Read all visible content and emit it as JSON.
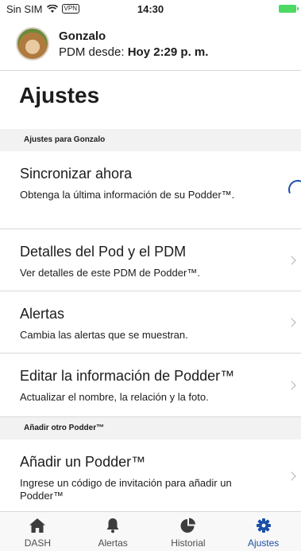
{
  "status": {
    "carrier": "Sin SIM",
    "vpn": "VPN",
    "time": "14:30"
  },
  "user": {
    "name": "Gonzalo",
    "pdm_prefix": "PDM desde:",
    "pdm_time": "Hoy 2:29 p. m."
  },
  "page_title": "Ajustes",
  "section_user": "Ajustes para Gonzalo",
  "rows": [
    {
      "title": "Sincronizar ahora",
      "description": "Obtenga la última información de su Podder™."
    },
    {
      "title": "Detalles del Pod y el PDM",
      "description": "Ver detalles de este PDM de Podder™."
    },
    {
      "title": "Alertas",
      "description": "Cambia las alertas que se muestran."
    },
    {
      "title": "Editar la información de Podder™",
      "description": "Actualizar el nombre, la relación y la foto."
    }
  ],
  "section_add": "Añadir otro Podder™",
  "add_row": {
    "title": "Añadir un Podder™",
    "description": "Ingrese un código de invitación para añadir un Podder™"
  },
  "tabs": [
    {
      "label": "DASH",
      "icon": "home-icon"
    },
    {
      "label": "Alertas",
      "icon": "bell-icon"
    },
    {
      "label": "Historial",
      "icon": "pie-chart-icon"
    },
    {
      "label": "Ajustes",
      "icon": "gear-icon"
    }
  ],
  "colors": {
    "accent": "#1b4fa6",
    "section_bg": "#f2f2f2",
    "battery": "#4cd964"
  }
}
